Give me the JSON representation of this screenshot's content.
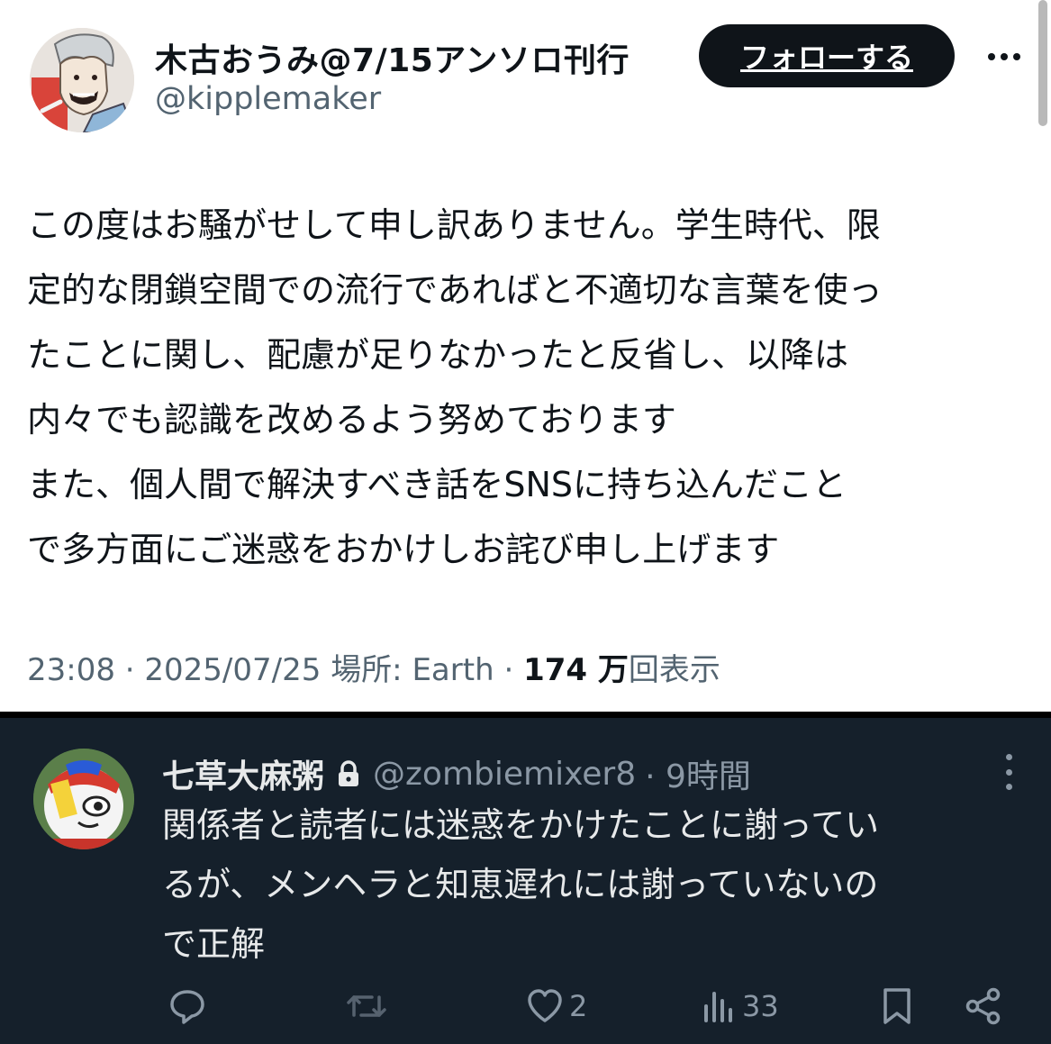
{
  "tweet": {
    "display_name": "木古おうみ@7/15アンソロ刊行",
    "handle": "@kipplemaker",
    "follow_label": "フォローする",
    "lines": [
      "この度はお騒がせして申し訳ありません。学生時代、限",
      "定的な閉鎖空間での流行であればと不適切な言葉を使っ",
      "たことに関し、配慮が足りなかったと反省し、以降は",
      "内々でも認識を改めるよう努めております",
      "また、個人間で解決すべき話をSNSに持ち込んだこと",
      "で多方面にご迷惑をおかけしお詫び申し上げます"
    ],
    "time": "23:08 · 2025/07/25",
    "location": "場所: Earth",
    "views_count": "174 万",
    "views_label": "回表示"
  },
  "reply": {
    "display_name": "七草大麻粥",
    "handle": "@zombiemixer8",
    "time": "· 9時間",
    "lines": [
      "関係者と読者には迷惑をかけたことに謝ってい",
      "るが、メンヘラと知恵遅れには謝っていないの",
      "で正解"
    ],
    "like_count": "2",
    "view_count": "33"
  },
  "colors": {
    "dark_bg": "#15202b",
    "text_primary": "#0f1419",
    "text_secondary": "#536471",
    "dark_text": "#e7e9ea",
    "dark_secondary": "#8b98a5"
  },
  "icons": {
    "lock": "lock-icon",
    "reply": "reply-icon",
    "retweet": "retweet-icon",
    "like": "heart-icon",
    "views": "views-icon",
    "bookmark": "bookmark-icon",
    "share": "share-icon",
    "more": "more-icon"
  }
}
